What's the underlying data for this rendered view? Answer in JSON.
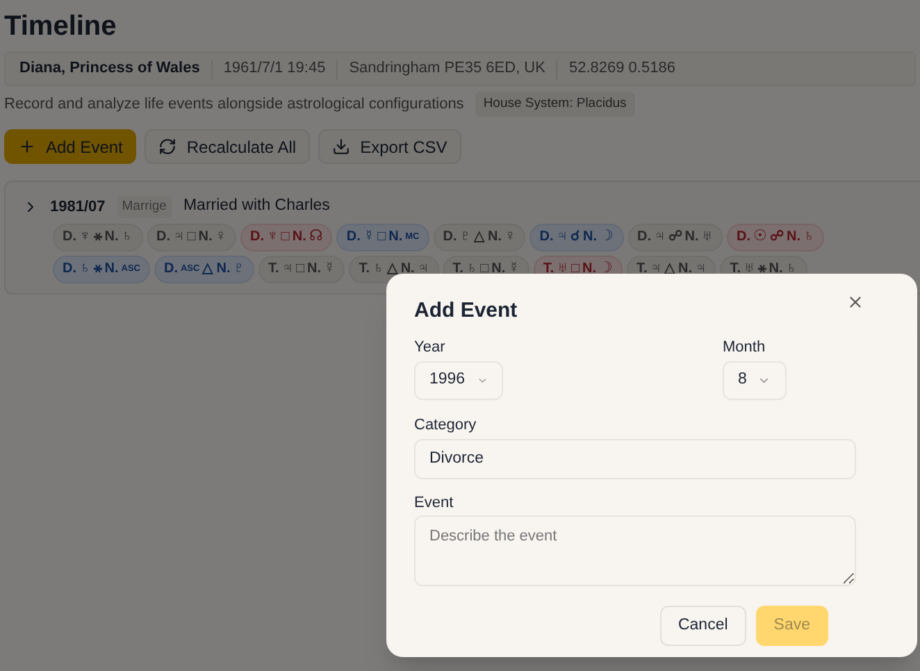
{
  "title": "Timeline",
  "person": {
    "name": "Diana, Princess of Wales",
    "birth": "1961/7/1 19:45",
    "place": "Sandringham PE35 6ED, UK",
    "coords": "52.8269 0.5186"
  },
  "description": "Record and analyze life events alongside astrological configurations",
  "house_system": "House System: Placidus",
  "actions": [
    {
      "label": "Add Event",
      "kind": "primary"
    },
    {
      "label": "Recalculate All",
      "kind": "recalc"
    },
    {
      "label": "Export CSV",
      "kind": "export"
    }
  ],
  "events": [
    {
      "date": "1981/07",
      "category": "Marrige",
      "title": "Married with Charles",
      "expanded": false,
      "aspect_rows": [
        [
          {
            "prefix": "D.",
            "a": "♆",
            "aspect": "⚹",
            "n": "N.",
            "b": "♄",
            "kind": "plain"
          },
          {
            "prefix": "D.",
            "a": "♃",
            "aspect": "□",
            "n": "N.",
            "b": "♀",
            "kind": "plain"
          },
          {
            "prefix": "D.",
            "a": "♆",
            "aspect": "□",
            "n": "N.",
            "b": "☊",
            "kind": "red"
          },
          {
            "prefix": "D.",
            "a": "☿",
            "aspect": "□",
            "n": "N.",
            "b": "MC",
            "kind": "blue"
          },
          {
            "prefix": "D.",
            "a": "♇",
            "aspect": "△",
            "n": "N.",
            "b": "♀",
            "kind": "plain"
          },
          {
            "prefix": "D.",
            "a": "♃",
            "aspect": "☌",
            "n": "N.",
            "b": "☽",
            "kind": "blue"
          },
          {
            "prefix": "D.",
            "a": "♃",
            "aspect": "☍",
            "n": "N.",
            "b": "♅",
            "kind": "plain"
          },
          {
            "prefix": "D.",
            "a": "☉",
            "aspect": "☍",
            "n": "N.",
            "b": "♄",
            "kind": "red"
          }
        ],
        [
          {
            "prefix": "D.",
            "a": "♄",
            "aspect": "⚹",
            "n": "N.",
            "b": "ASC",
            "kind": "blue"
          },
          {
            "prefix": "D.",
            "a": "ASC",
            "aspect": "△",
            "n": "N.",
            "b": "♇",
            "kind": "blue"
          },
          {
            "prefix": "T.",
            "a": "♃",
            "aspect": "□",
            "n": "N.",
            "b": "☿",
            "kind": "plain"
          },
          {
            "prefix": "T.",
            "a": "♄",
            "aspect": "△",
            "n": "N.",
            "b": "♃",
            "kind": "plain"
          },
          {
            "prefix": "T.",
            "a": "♄",
            "aspect": "□",
            "n": "N.",
            "b": "☿",
            "kind": "plain"
          },
          {
            "prefix": "T.",
            "a": "♅",
            "aspect": "□",
            "n": "N.",
            "b": "☽",
            "kind": "red"
          },
          {
            "prefix": "T.",
            "a": "♃",
            "aspect": "△",
            "n": "N.",
            "b": "♃",
            "kind": "plain"
          },
          {
            "prefix": "T.",
            "a": "♅",
            "aspect": "⚹",
            "n": "N.",
            "b": "♄",
            "kind": "plain"
          }
        ]
      ]
    }
  ],
  "dialog": {
    "title": "Add Event",
    "year_label": "Year",
    "year": "1996",
    "month_label": "Month",
    "month": "8",
    "category_label": "Category",
    "category": "Divorce",
    "event_label": "Event",
    "event_placeholder": "Describe the event",
    "buttons": [
      {
        "label": "Cancel",
        "kind": "secondary",
        "disabled": false
      },
      {
        "label": "Save",
        "kind": "primary",
        "disabled": true
      }
    ]
  }
}
